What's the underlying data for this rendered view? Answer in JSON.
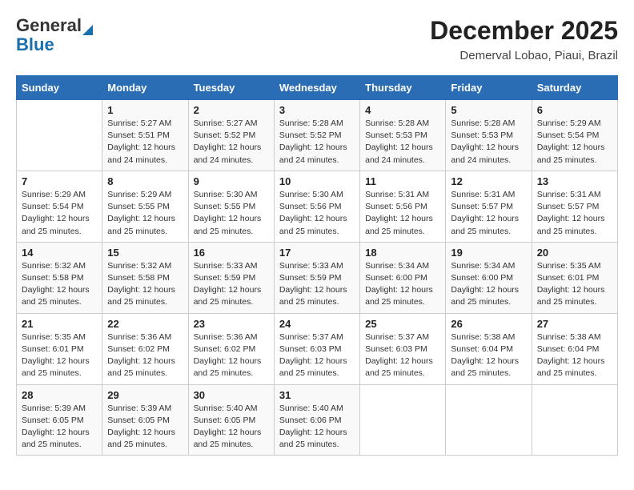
{
  "header": {
    "logo_top": "General",
    "logo_bottom": "Blue",
    "month": "December 2025",
    "location": "Demerval Lobao, Piaui, Brazil"
  },
  "weekdays": [
    "Sunday",
    "Monday",
    "Tuesday",
    "Wednesday",
    "Thursday",
    "Friday",
    "Saturday"
  ],
  "weeks": [
    [
      {
        "day": "",
        "info": ""
      },
      {
        "day": "1",
        "info": "Sunrise: 5:27 AM\nSunset: 5:51 PM\nDaylight: 12 hours\nand 24 minutes."
      },
      {
        "day": "2",
        "info": "Sunrise: 5:27 AM\nSunset: 5:52 PM\nDaylight: 12 hours\nand 24 minutes."
      },
      {
        "day": "3",
        "info": "Sunrise: 5:28 AM\nSunset: 5:52 PM\nDaylight: 12 hours\nand 24 minutes."
      },
      {
        "day": "4",
        "info": "Sunrise: 5:28 AM\nSunset: 5:53 PM\nDaylight: 12 hours\nand 24 minutes."
      },
      {
        "day": "5",
        "info": "Sunrise: 5:28 AM\nSunset: 5:53 PM\nDaylight: 12 hours\nand 24 minutes."
      },
      {
        "day": "6",
        "info": "Sunrise: 5:29 AM\nSunset: 5:54 PM\nDaylight: 12 hours\nand 25 minutes."
      }
    ],
    [
      {
        "day": "7",
        "info": "Sunrise: 5:29 AM\nSunset: 5:54 PM\nDaylight: 12 hours\nand 25 minutes."
      },
      {
        "day": "8",
        "info": "Sunrise: 5:29 AM\nSunset: 5:55 PM\nDaylight: 12 hours\nand 25 minutes."
      },
      {
        "day": "9",
        "info": "Sunrise: 5:30 AM\nSunset: 5:55 PM\nDaylight: 12 hours\nand 25 minutes."
      },
      {
        "day": "10",
        "info": "Sunrise: 5:30 AM\nSunset: 5:56 PM\nDaylight: 12 hours\nand 25 minutes."
      },
      {
        "day": "11",
        "info": "Sunrise: 5:31 AM\nSunset: 5:56 PM\nDaylight: 12 hours\nand 25 minutes."
      },
      {
        "day": "12",
        "info": "Sunrise: 5:31 AM\nSunset: 5:57 PM\nDaylight: 12 hours\nand 25 minutes."
      },
      {
        "day": "13",
        "info": "Sunrise: 5:31 AM\nSunset: 5:57 PM\nDaylight: 12 hours\nand 25 minutes."
      }
    ],
    [
      {
        "day": "14",
        "info": "Sunrise: 5:32 AM\nSunset: 5:58 PM\nDaylight: 12 hours\nand 25 minutes."
      },
      {
        "day": "15",
        "info": "Sunrise: 5:32 AM\nSunset: 5:58 PM\nDaylight: 12 hours\nand 25 minutes."
      },
      {
        "day": "16",
        "info": "Sunrise: 5:33 AM\nSunset: 5:59 PM\nDaylight: 12 hours\nand 25 minutes."
      },
      {
        "day": "17",
        "info": "Sunrise: 5:33 AM\nSunset: 5:59 PM\nDaylight: 12 hours\nand 25 minutes."
      },
      {
        "day": "18",
        "info": "Sunrise: 5:34 AM\nSunset: 6:00 PM\nDaylight: 12 hours\nand 25 minutes."
      },
      {
        "day": "19",
        "info": "Sunrise: 5:34 AM\nSunset: 6:00 PM\nDaylight: 12 hours\nand 25 minutes."
      },
      {
        "day": "20",
        "info": "Sunrise: 5:35 AM\nSunset: 6:01 PM\nDaylight: 12 hours\nand 25 minutes."
      }
    ],
    [
      {
        "day": "21",
        "info": "Sunrise: 5:35 AM\nSunset: 6:01 PM\nDaylight: 12 hours\nand 25 minutes."
      },
      {
        "day": "22",
        "info": "Sunrise: 5:36 AM\nSunset: 6:02 PM\nDaylight: 12 hours\nand 25 minutes."
      },
      {
        "day": "23",
        "info": "Sunrise: 5:36 AM\nSunset: 6:02 PM\nDaylight: 12 hours\nand 25 minutes."
      },
      {
        "day": "24",
        "info": "Sunrise: 5:37 AM\nSunset: 6:03 PM\nDaylight: 12 hours\nand 25 minutes."
      },
      {
        "day": "25",
        "info": "Sunrise: 5:37 AM\nSunset: 6:03 PM\nDaylight: 12 hours\nand 25 minutes."
      },
      {
        "day": "26",
        "info": "Sunrise: 5:38 AM\nSunset: 6:04 PM\nDaylight: 12 hours\nand 25 minutes."
      },
      {
        "day": "27",
        "info": "Sunrise: 5:38 AM\nSunset: 6:04 PM\nDaylight: 12 hours\nand 25 minutes."
      }
    ],
    [
      {
        "day": "28",
        "info": "Sunrise: 5:39 AM\nSunset: 6:05 PM\nDaylight: 12 hours\nand 25 minutes."
      },
      {
        "day": "29",
        "info": "Sunrise: 5:39 AM\nSunset: 6:05 PM\nDaylight: 12 hours\nand 25 minutes."
      },
      {
        "day": "30",
        "info": "Sunrise: 5:40 AM\nSunset: 6:05 PM\nDaylight: 12 hours\nand 25 minutes."
      },
      {
        "day": "31",
        "info": "Sunrise: 5:40 AM\nSunset: 6:06 PM\nDaylight: 12 hours\nand 25 minutes."
      },
      {
        "day": "",
        "info": ""
      },
      {
        "day": "",
        "info": ""
      },
      {
        "day": "",
        "info": ""
      }
    ]
  ]
}
